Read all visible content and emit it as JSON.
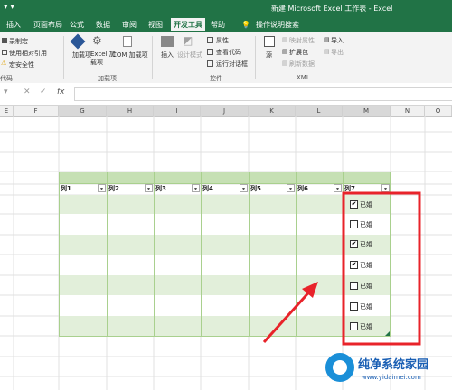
{
  "window": {
    "title": "新建 Microsoft Excel 工作表 - Excel"
  },
  "colors": {
    "excel_green": "#217346",
    "table_header": "#c6e0b4",
    "table_band": "#e2efda",
    "highlight": "#e8232a"
  },
  "tabs": [
    {
      "label": "插入"
    },
    {
      "label": "页面布局"
    },
    {
      "label": "公式"
    },
    {
      "label": "数据"
    },
    {
      "label": "审阅"
    },
    {
      "label": "视图"
    },
    {
      "label": "开发工具"
    },
    {
      "label": "帮助"
    },
    {
      "label": "操作说明搜索"
    }
  ],
  "ribbon": {
    "code": {
      "record": "录制宏",
      "relative": "使用相对引用",
      "security": "宏安全性",
      "group": "代码"
    },
    "addins": {
      "addin": "加载项",
      "excel_addin": "Excel 加载项",
      "com_addin": "COM 加载项",
      "group": "加载项"
    },
    "controls": {
      "insert": "插入",
      "design": "设计模式",
      "properties": "属性",
      "view_code": "查看代码",
      "run_dialog": "运行对话框",
      "group": "控件"
    },
    "xml": {
      "source": "源",
      "map_props": "映射属性",
      "expansion": "扩展包",
      "refresh": "刷新数据",
      "import": "导入",
      "export": "导出",
      "group": "XML"
    }
  },
  "formula_bar": {
    "value": ""
  },
  "columns": [
    "E",
    "F",
    "G",
    "H",
    "I",
    "J",
    "K",
    "L",
    "M",
    "N",
    "O"
  ],
  "table": {
    "headers": [
      "列1",
      "列2",
      "列3",
      "列4",
      "列5",
      "列6",
      "列7"
    ],
    "checkboxes": [
      {
        "label": "已婚",
        "checked": true
      },
      {
        "label": "已婚",
        "checked": false
      },
      {
        "label": "已婚",
        "checked": true
      },
      {
        "label": "已婚",
        "checked": true
      },
      {
        "label": "已婚",
        "checked": false
      },
      {
        "label": "已婚",
        "checked": false
      },
      {
        "label": "已婚",
        "checked": false
      }
    ]
  },
  "watermark": {
    "text": "纯净系统家园",
    "url": "www.yidaimei.com"
  }
}
